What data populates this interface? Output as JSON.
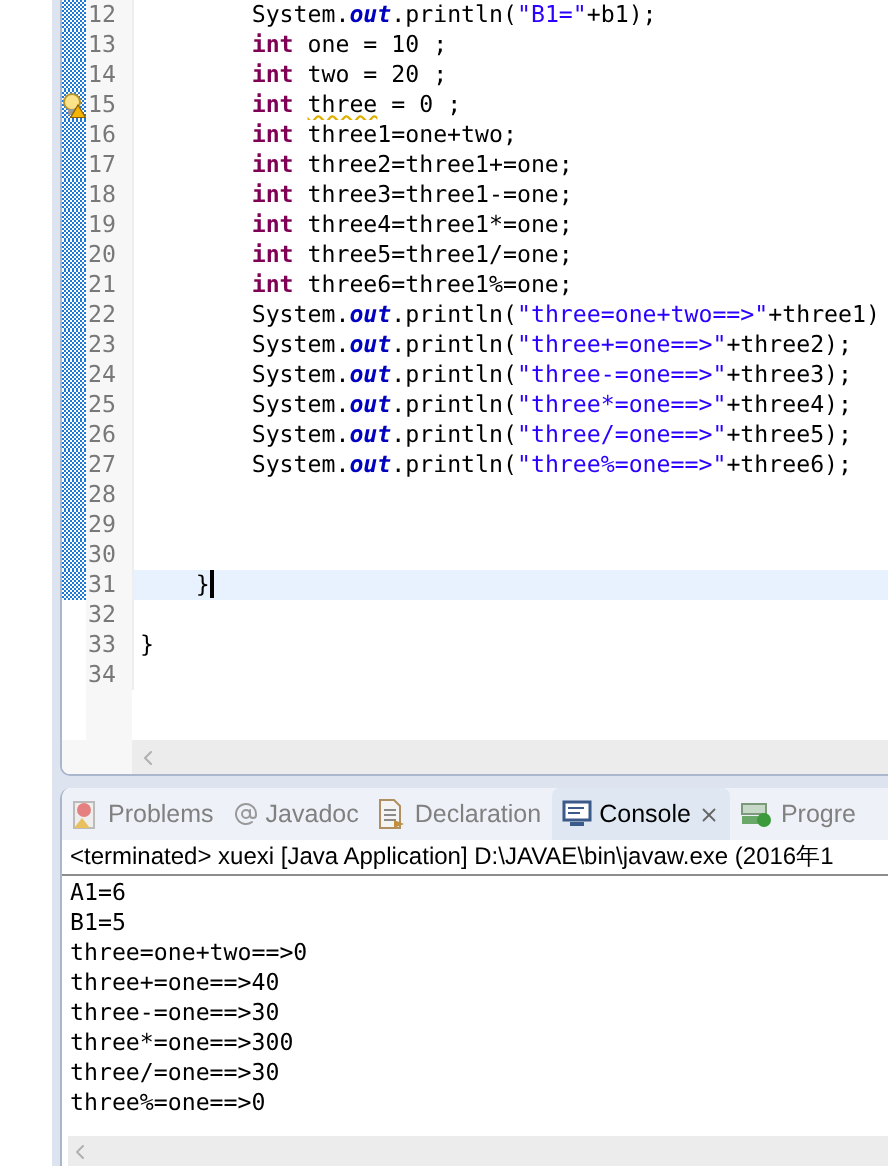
{
  "editor": {
    "lines": [
      {
        "number": "12",
        "changed": true,
        "current": false,
        "tokens": [
          {
            "kind": "plain",
            "text": "        System."
          },
          {
            "kind": "field",
            "text": "out"
          },
          {
            "kind": "plain",
            "text": ".println("
          },
          {
            "kind": "string",
            "text": "\"B1=\""
          },
          {
            "kind": "plain",
            "text": "+b1);"
          }
        ]
      },
      {
        "number": "13",
        "changed": true,
        "current": false,
        "tokens": [
          {
            "kind": "keyword",
            "text": "        int"
          },
          {
            "kind": "plain",
            "text": " one = 10 ;"
          }
        ]
      },
      {
        "number": "14",
        "changed": true,
        "current": false,
        "tokens": [
          {
            "kind": "keyword",
            "text": "        int"
          },
          {
            "kind": "plain",
            "text": " two = 20 ;"
          }
        ]
      },
      {
        "number": "15",
        "changed": true,
        "current": false,
        "warning_marker": true,
        "tokens": [
          {
            "kind": "keyword",
            "text": "        int "
          },
          {
            "kind": "plain",
            "text": "three",
            "warning": true
          },
          {
            "kind": "plain",
            "text": " = 0 ;"
          }
        ]
      },
      {
        "number": "16",
        "changed": true,
        "current": false,
        "tokens": [
          {
            "kind": "keyword",
            "text": "        int"
          },
          {
            "kind": "plain",
            "text": " three1=one+two;"
          }
        ]
      },
      {
        "number": "17",
        "changed": true,
        "current": false,
        "tokens": [
          {
            "kind": "keyword",
            "text": "        int"
          },
          {
            "kind": "plain",
            "text": " three2=three1+=one;"
          }
        ]
      },
      {
        "number": "18",
        "changed": true,
        "current": false,
        "tokens": [
          {
            "kind": "keyword",
            "text": "        int"
          },
          {
            "kind": "plain",
            "text": " three3=three1-=one;"
          }
        ]
      },
      {
        "number": "19",
        "changed": true,
        "current": false,
        "tokens": [
          {
            "kind": "keyword",
            "text": "        int"
          },
          {
            "kind": "plain",
            "text": " three4=three1*=one;"
          }
        ]
      },
      {
        "number": "20",
        "changed": true,
        "current": false,
        "tokens": [
          {
            "kind": "keyword",
            "text": "        int"
          },
          {
            "kind": "plain",
            "text": " three5=three1/=one;"
          }
        ]
      },
      {
        "number": "21",
        "changed": true,
        "current": false,
        "tokens": [
          {
            "kind": "keyword",
            "text": "        int"
          },
          {
            "kind": "plain",
            "text": " three6=three1%=one;"
          }
        ]
      },
      {
        "number": "22",
        "changed": true,
        "current": false,
        "tokens": [
          {
            "kind": "plain",
            "text": "        System."
          },
          {
            "kind": "field",
            "text": "out"
          },
          {
            "kind": "plain",
            "text": ".println("
          },
          {
            "kind": "string",
            "text": "\"three=one+two==>\""
          },
          {
            "kind": "plain",
            "text": "+three1)"
          }
        ]
      },
      {
        "number": "23",
        "changed": true,
        "current": false,
        "tokens": [
          {
            "kind": "plain",
            "text": "        System."
          },
          {
            "kind": "field",
            "text": "out"
          },
          {
            "kind": "plain",
            "text": ".println("
          },
          {
            "kind": "string",
            "text": "\"three+=one==>\""
          },
          {
            "kind": "plain",
            "text": "+three2);"
          }
        ]
      },
      {
        "number": "24",
        "changed": true,
        "current": false,
        "tokens": [
          {
            "kind": "plain",
            "text": "        System."
          },
          {
            "kind": "field",
            "text": "out"
          },
          {
            "kind": "plain",
            "text": ".println("
          },
          {
            "kind": "string",
            "text": "\"three-=one==>\""
          },
          {
            "kind": "plain",
            "text": "+three3);"
          }
        ]
      },
      {
        "number": "25",
        "changed": true,
        "current": false,
        "tokens": [
          {
            "kind": "plain",
            "text": "        System."
          },
          {
            "kind": "field",
            "text": "out"
          },
          {
            "kind": "plain",
            "text": ".println("
          },
          {
            "kind": "string",
            "text": "\"three*=one==>\""
          },
          {
            "kind": "plain",
            "text": "+three4);"
          }
        ]
      },
      {
        "number": "26",
        "changed": true,
        "current": false,
        "tokens": [
          {
            "kind": "plain",
            "text": "        System."
          },
          {
            "kind": "field",
            "text": "out"
          },
          {
            "kind": "plain",
            "text": ".println("
          },
          {
            "kind": "string",
            "text": "\"three/=one==>\""
          },
          {
            "kind": "plain",
            "text": "+three5);"
          }
        ]
      },
      {
        "number": "27",
        "changed": true,
        "current": false,
        "tokens": [
          {
            "kind": "plain",
            "text": "        System."
          },
          {
            "kind": "field",
            "text": "out"
          },
          {
            "kind": "plain",
            "text": ".println("
          },
          {
            "kind": "string",
            "text": "\"three%=one==>\""
          },
          {
            "kind": "plain",
            "text": "+three6);"
          }
        ]
      },
      {
        "number": "28",
        "changed": true,
        "current": false
      },
      {
        "number": "29",
        "changed": true,
        "current": false
      },
      {
        "number": "30",
        "changed": true,
        "current": false
      },
      {
        "number": "31",
        "changed": true,
        "current": true,
        "tokens": [
          {
            "kind": "plain",
            "text": "    }"
          }
        ]
      },
      {
        "number": "32",
        "changed": false,
        "current": false
      },
      {
        "number": "33",
        "changed": false,
        "current": false,
        "tokens": [
          {
            "kind": "plain",
            "text": "}"
          }
        ]
      },
      {
        "number": "34",
        "changed": false,
        "current": false
      }
    ]
  },
  "console": {
    "tabs": [
      {
        "kind": "problems",
        "label": "Problems",
        "selected": false
      },
      {
        "kind": "javadoc",
        "label": "Javadoc",
        "selected": false
      },
      {
        "kind": "declaration",
        "label": "Declaration",
        "selected": false
      },
      {
        "kind": "console",
        "label": "Console",
        "selected": true
      },
      {
        "kind": "progress",
        "label": "Progre",
        "selected": false
      }
    ],
    "header": "<terminated> xuexi [Java Application] D:\\JAVAE\\bin\\javaw.exe (2016年1",
    "output": [
      "A1=6",
      "B1=5",
      "three=one+two==>0",
      "three+=one==>40",
      "three-=one==>30",
      "three*=one==>300",
      "three/=one==>30",
      "three%=one==>0"
    ]
  }
}
